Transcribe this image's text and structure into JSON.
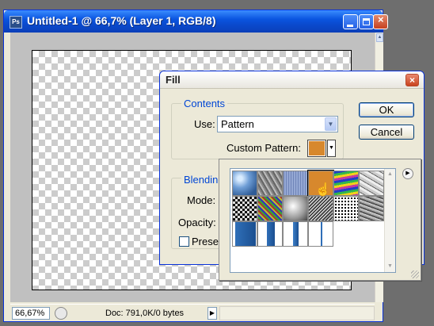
{
  "document_window": {
    "title": "Untitled-1 @ 66,7% (Layer 1, RGB/8)",
    "app_icon": "Ps",
    "status_bar": {
      "zoom": "66,67%",
      "doc_info": "Doc: 791,0K/0 bytes"
    }
  },
  "fill_dialog": {
    "title": "Fill",
    "contents_group_label": "Contents",
    "use_label": "Use:",
    "use_value": "Pattern",
    "custom_pattern_label": "Custom Pattern:",
    "blending_group_label": "Blending",
    "mode_label": "Mode:",
    "opacity_label": "Opacity:",
    "preserve_label": "Preserve",
    "ok_label": "OK",
    "cancel_label": "Cancel",
    "selected_pattern_color": "#d7882d"
  },
  "pattern_picker": {
    "patterns": [
      {
        "name": "bubbles"
      },
      {
        "name": "wrinkles"
      },
      {
        "name": "blue-fiber"
      },
      {
        "name": "orange-solid"
      },
      {
        "name": "rainbow-waves"
      },
      {
        "name": "crumpled-paper"
      },
      {
        "name": "checker-texture"
      },
      {
        "name": "color-noise"
      },
      {
        "name": "clouds"
      },
      {
        "name": "dense-noise"
      },
      {
        "name": "black-dots"
      },
      {
        "name": "granite"
      },
      {
        "name": "blue-gradient-wide"
      },
      {
        "name": "blue-gradient-narrow"
      },
      {
        "name": "blue-gradient-thin"
      },
      {
        "name": "blue-line"
      }
    ],
    "selected_index": 3
  }
}
